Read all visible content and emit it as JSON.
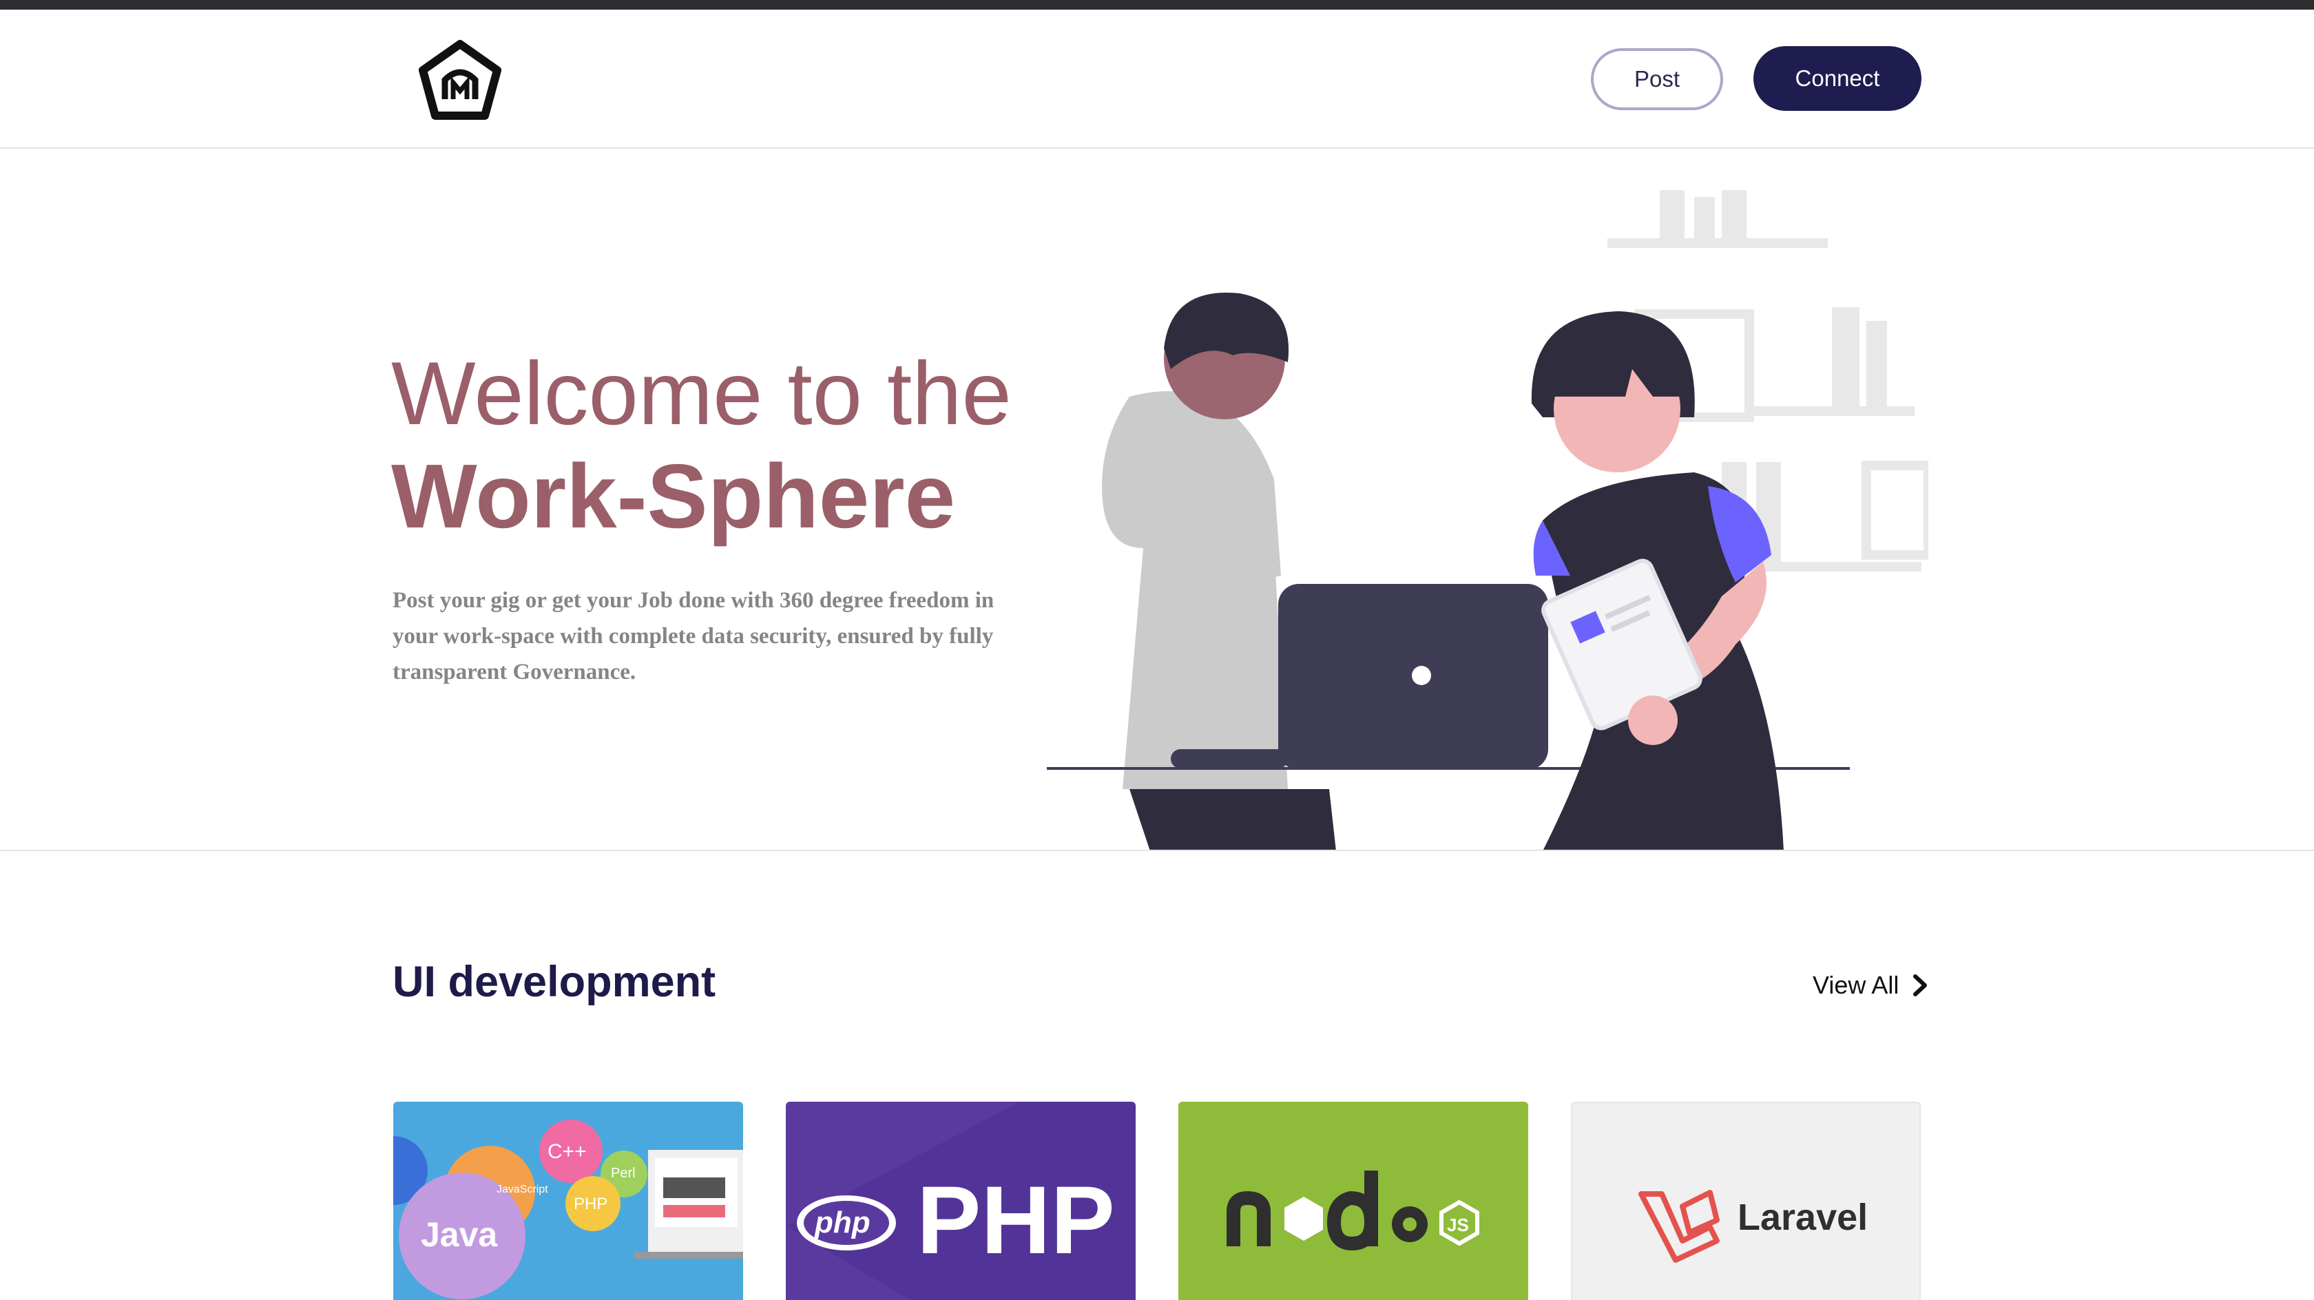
{
  "nav": {
    "post_label": "Post",
    "connect_label": "Connect",
    "logo_icon": "workspace-logo-icon"
  },
  "hero": {
    "title_line1": "Welcome to the",
    "title_line2": "Work-Sphere",
    "description": "Post your gig or get your Job done with 360 degree freedom in your work-space with complete data security, ensured by fully transparent Governance.",
    "illustration": "people-working-with-laptop-illustration"
  },
  "section": {
    "title": "UI development",
    "view_all_label": "View All",
    "view_all_icon": "chevron-right-icon"
  },
  "cards": [
    {
      "name": "Java",
      "bubbles": [
        "C++",
        "Perl",
        "JavaScript",
        "PHP",
        "Java"
      ],
      "color": "#4ba8de"
    },
    {
      "name": "PHP",
      "badge": "php",
      "color": "#5b3aa0"
    },
    {
      "name": "node",
      "badge": "JS",
      "color": "#8fbb3b"
    },
    {
      "name": "Laravel",
      "color": "#f0f0f0"
    }
  ],
  "colors": {
    "brand_dark": "#1f1c4f",
    "hero_title": "#9a5f68",
    "accent_purple": "#6c63ff"
  }
}
